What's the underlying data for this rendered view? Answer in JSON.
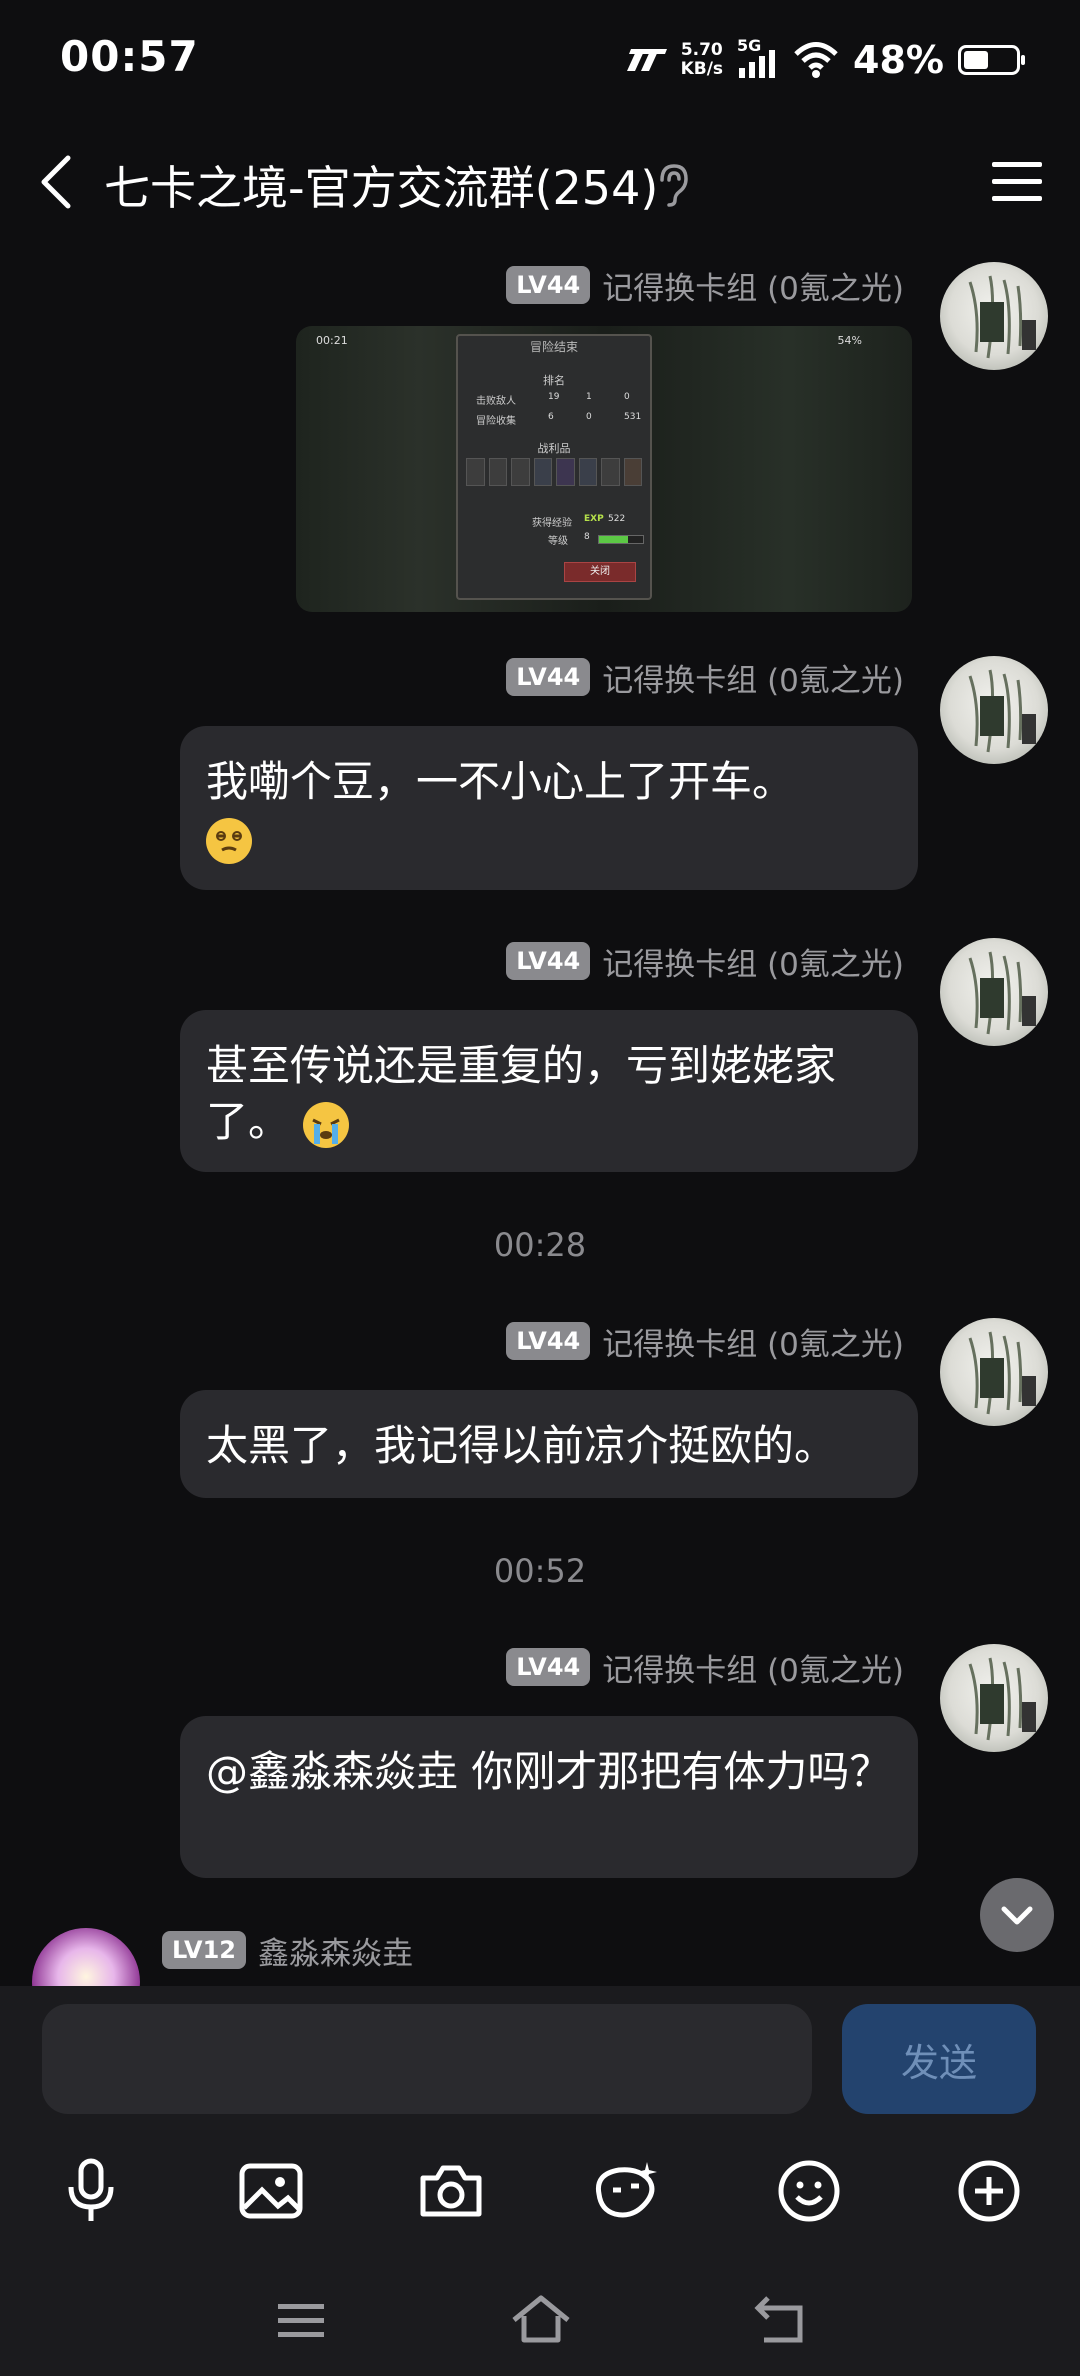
{
  "status": {
    "time": "00:57",
    "net_speed_value": "5.70",
    "net_speed_unit": "KB/s",
    "network": "5G",
    "battery_pct": "48%",
    "battery_level": 0.48
  },
  "header": {
    "title": "七卡之境-官方交流群(254)"
  },
  "messages": [
    {
      "level": "LV44",
      "sender": "记得换卡组 (0氪之光)",
      "type": "image",
      "image_text": {
        "time": "00:21",
        "title": "冒险结束",
        "rank": "排名",
        "defeat_label": "击败敌人",
        "defeat_values": [
          "19",
          "1",
          "0"
        ],
        "collect_label": "冒险收集",
        "collect_values": [
          "6",
          "0",
          "531"
        ],
        "loot_label": "战利品",
        "exp_label": "获得经验",
        "exp_tag": "EXP",
        "exp_value": "522",
        "level_label": "等级",
        "level_value": "8",
        "close_label": "关闭",
        "battery": "54%"
      }
    },
    {
      "level": "LV44",
      "sender": "记得换卡组 (0氪之光)",
      "type": "text",
      "text": "我嘞个豆，一不小心上了开车。"
    },
    {
      "level": "LV44",
      "sender": "记得换卡组 (0氪之光)",
      "type": "text",
      "text": "甚至传说还是重复的，亏到姥姥家了。"
    },
    {
      "level": "LV44",
      "sender": "记得换卡组 (0氪之光)",
      "type": "text",
      "text": "太黑了，我记得以前凉介挺欧的。"
    },
    {
      "level": "LV44",
      "sender": "记得换卡组 (0氪之光)",
      "type": "text",
      "text": "@鑫淼森焱垚 你刚才那把有体力吗？"
    },
    {
      "level": "LV12",
      "sender": "鑫淼森焱垚",
      "type": "partial"
    }
  ],
  "timestamps": [
    "00:28",
    "00:52"
  ],
  "input": {
    "placeholder": "",
    "send_label": "发送"
  },
  "toolbar": [
    "mic-icon",
    "image-icon",
    "camera-icon",
    "sticker-icon",
    "emoji-icon",
    "plus-icon"
  ],
  "nav": [
    "menu-icon",
    "home-icon",
    "back-icon"
  ],
  "colors": {
    "background": "#0e0e10",
    "bubble": "#2a2a2e",
    "level_badge": "#8a8a8e",
    "send_button": "#23436e",
    "send_text": "#6f8fb8"
  }
}
